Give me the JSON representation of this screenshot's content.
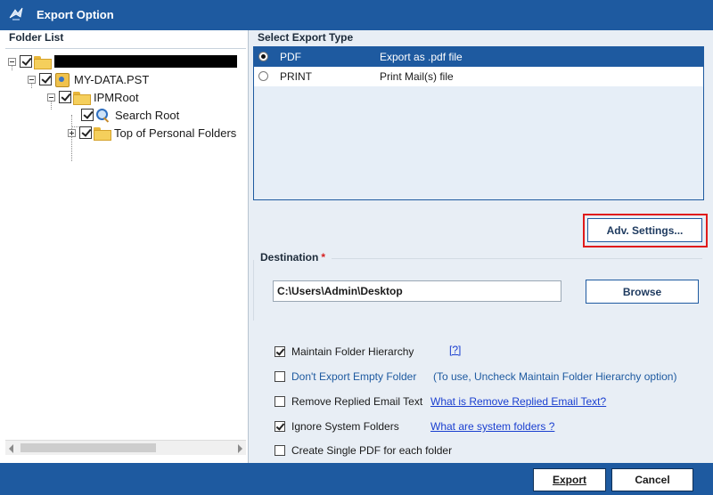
{
  "window": {
    "title": "Export Option",
    "icon": "app-logo-icon"
  },
  "folder_list": {
    "header": "Folder List",
    "items": [
      {
        "label": "",
        "redacted": true,
        "checked": true,
        "expander": "minus",
        "icon": "folder-icon"
      },
      {
        "label": "MY-DATA.PST",
        "checked": true,
        "expander": "minus",
        "icon": "pst-icon"
      },
      {
        "label": "IPMRoot",
        "checked": true,
        "expander": "minus",
        "icon": "folder-icon"
      },
      {
        "label": "Search Root",
        "checked": true,
        "expander": "none",
        "icon": "search-icon"
      },
      {
        "label": "Top of Personal Folders",
        "checked": true,
        "expander": "plus",
        "icon": "folder-icon"
      }
    ]
  },
  "export_type": {
    "header": "Select Export Type",
    "options": [
      {
        "name": "PDF",
        "description": "Export as .pdf file",
        "selected": true
      },
      {
        "name": "PRINT",
        "description": "Print Mail(s) file",
        "selected": false
      }
    ]
  },
  "adv_settings_label": "Adv. Settings...",
  "destination": {
    "label": "Destination",
    "required_mark": "*",
    "path": "C:\\Users\\Admin\\Desktop",
    "browse_label": "Browse"
  },
  "options": {
    "maintain_hierarchy": {
      "label": "Maintain Folder Hierarchy",
      "checked": true,
      "help": "[?]"
    },
    "dont_export_empty": {
      "label": "Don't Export Empty Folder",
      "checked": false,
      "hint": "(To use, Uncheck Maintain Folder Hierarchy option)"
    },
    "remove_replied": {
      "label": "Remove Replied Email Text",
      "checked": false,
      "link": "What is Remove Replied Email Text?"
    },
    "ignore_system": {
      "label": "Ignore System Folders",
      "checked": true,
      "link": "What are system folders ?"
    },
    "single_pdf": {
      "label": "Create Single PDF for each folder",
      "checked": false
    }
  },
  "footer": {
    "export_label": "Export",
    "cancel_label": "Cancel"
  },
  "colors": {
    "accent": "#1e5aa0",
    "highlight_outline": "#e01b1b",
    "link": "#1a3fd0",
    "required": "#d62020"
  }
}
